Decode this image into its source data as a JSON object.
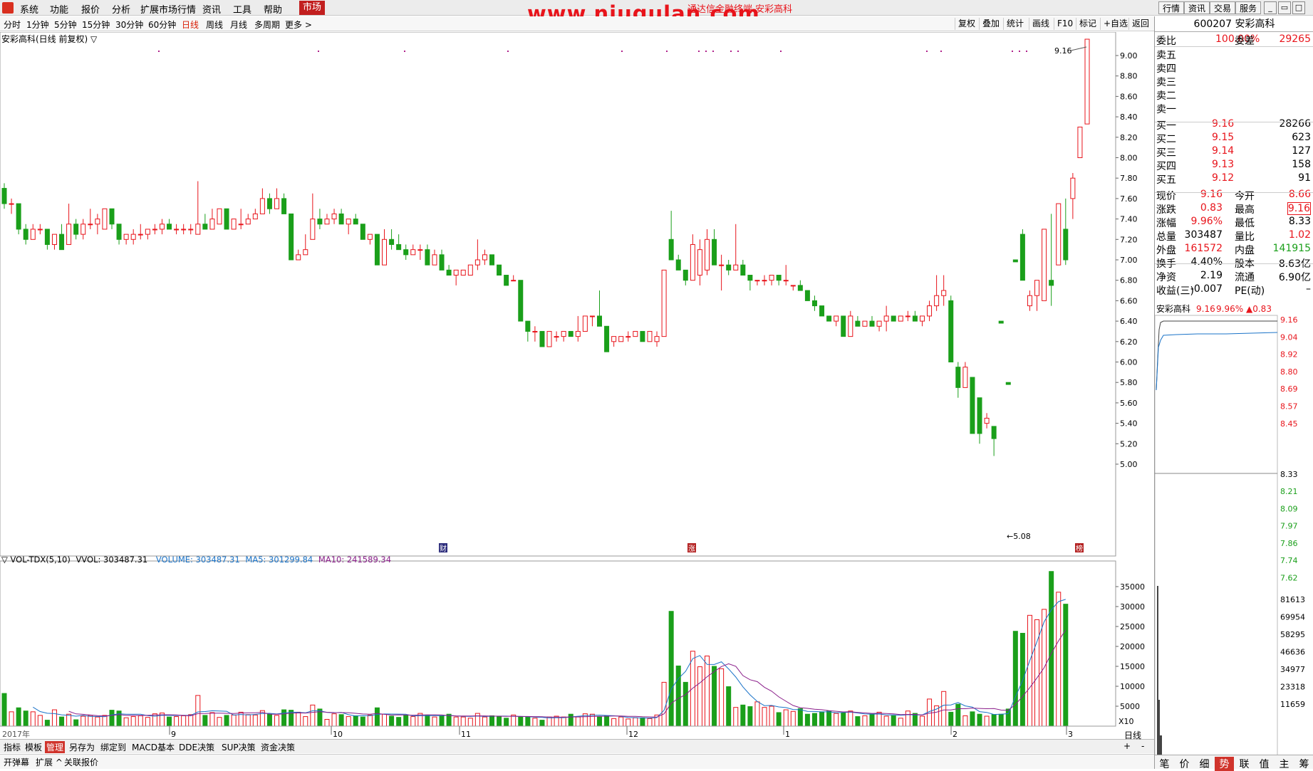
{
  "menu": {
    "items": [
      "系统",
      "功能",
      "报价",
      "分析",
      "扩展市场行情",
      "资讯",
      "工具",
      "帮助"
    ],
    "active": "市场",
    "right": [
      "行情",
      "资讯",
      "交易",
      "服务"
    ],
    "window_controls": [
      "_",
      "▭",
      "□",
      "×"
    ]
  },
  "watermark": {
    "text": "www.niugulan.com",
    "subtitle": "通达信金融终端 安彩高科"
  },
  "periods": {
    "items": [
      "分时",
      "1分钟",
      "5分钟",
      "15分钟",
      "30分钟",
      "60分钟",
      "日线",
      "周线",
      "月线",
      "多周期",
      "更多 >"
    ],
    "active": "日线"
  },
  "chart_tools": [
    "复权",
    "叠加",
    "统计",
    "画线",
    "F10",
    "标记",
    "+自选",
    "返回"
  ],
  "chart_title": "安彩高科(日线 前复权) ▽",
  "price_axis": [
    "9.00",
    "8.80",
    "8.60",
    "8.40",
    "8.20",
    "8.00",
    "7.80",
    "7.60",
    "7.40",
    "7.20",
    "7.00",
    "6.80",
    "6.60",
    "6.40",
    "6.20",
    "6.00",
    "5.80",
    "5.60",
    "5.40",
    "5.20",
    "5.00"
  ],
  "price_annot": {
    "high": "9.16",
    "low": "5.08"
  },
  "vol_header": {
    "name": "▽ VOL-TDX(5,10)",
    "vvol": "VVOL: 303487.31",
    "volume": "VOLUME: 303487.31",
    "ma5": "MA5: 301299.84",
    "ma10": "MA10: 241589.34"
  },
  "vol_axis": [
    "35000",
    "30000",
    "25000",
    "20000",
    "15000",
    "10000",
    "5000"
  ],
  "vol_unit": "X10",
  "date_axis": {
    "year": "2017年",
    "months": [
      "9",
      "10",
      "11",
      "12",
      "1",
      "2",
      "3"
    ]
  },
  "markers": [
    "财",
    "涨",
    "榜"
  ],
  "bottom_tabs": [
    "指标",
    "模板",
    "管理",
    "另存为",
    "绑定到",
    "MACD基本",
    "DDE决策",
    "SUP决策",
    "资金决策"
  ],
  "bottom_active": "管理",
  "bottom_right": [
    "+",
    "-",
    "日线"
  ],
  "status_items": [
    "开弹幕",
    "扩展 ^",
    "关联报价"
  ],
  "quote": {
    "code_name": "600207 安彩高科",
    "wb": {
      "label": "委比",
      "value": "100.00%",
      "label2": "委差",
      "value2": "29265"
    },
    "sells": [
      "卖五",
      "卖四",
      "卖三",
      "卖二",
      "卖一"
    ],
    "buys": [
      {
        "l": "买一",
        "p": "9.16",
        "v": "28266"
      },
      {
        "l": "买二",
        "p": "9.15",
        "v": "623"
      },
      {
        "l": "买三",
        "p": "9.14",
        "v": "127"
      },
      {
        "l": "买四",
        "p": "9.13",
        "v": "158"
      },
      {
        "l": "买五",
        "p": "9.12",
        "v": "91"
      }
    ],
    "stats": [
      {
        "l1": "现价",
        "v1": "9.16",
        "l2": "今开",
        "v2": "8.66"
      },
      {
        "l1": "涨跌",
        "v1": "0.83",
        "l2": "最高",
        "v2": "9.16"
      },
      {
        "l1": "涨幅",
        "v1": "9.96%",
        "l2": "最低",
        "v2": "8.33"
      },
      {
        "l1": "总量",
        "v1": "303487",
        "l2": "量比",
        "v2": "1.02"
      },
      {
        "l1": "外盘",
        "v1": "161572",
        "l2": "内盘",
        "v2": "141915"
      },
      {
        "l1": "换手",
        "v1": "4.40%",
        "l2": "股本",
        "v2": "8.63亿"
      },
      {
        "l1": "净资",
        "v1": "2.19",
        "l2": "流通",
        "v2": "6.90亿"
      },
      {
        "l1": "收益(三)",
        "v1": "-0.007",
        "l2": "PE(动)",
        "v2": "–"
      }
    ],
    "mini_title": "安彩高科",
    "mini_price": "9.16",
    "mini_pct": "9.96%",
    "mini_chg": "▲0.83",
    "mini_axis_red": [
      "9.16",
      "9.04",
      "8.92",
      "8.80",
      "8.69",
      "8.57",
      "8.45"
    ],
    "mini_axis_mid": "8.33",
    "mini_axis_green": [
      "8.21",
      "8.09",
      "7.97",
      "7.86",
      "7.74",
      "7.62"
    ],
    "mini_vol_axis": [
      "81613",
      "69954",
      "58295",
      "46636",
      "34977",
      "23318",
      "11659"
    ],
    "tabs": [
      "笔",
      "价",
      "细",
      "势",
      "联",
      "值",
      "主",
      "筹"
    ],
    "tab_active": "势"
  },
  "chart_data": {
    "type": "candlestick",
    "title": "安彩高科(日线 前复权)",
    "ylim": [
      5.0,
      9.16
    ],
    "candles": [
      [
        7.7,
        7.75,
        7.5,
        7.55
      ],
      [
        7.55,
        7.6,
        7.45,
        7.55
      ],
      [
        7.55,
        7.55,
        7.25,
        7.3
      ],
      [
        7.3,
        7.35,
        7.15,
        7.2
      ],
      [
        7.2,
        7.35,
        7.2,
        7.3
      ],
      [
        7.3,
        7.35,
        7.25,
        7.3
      ],
      [
        7.3,
        7.3,
        7.1,
        7.15
      ],
      [
        7.15,
        7.25,
        7.1,
        7.25
      ],
      [
        7.25,
        7.35,
        7.1,
        7.1
      ],
      [
        7.15,
        7.55,
        7.15,
        7.35
      ],
      [
        7.35,
        7.4,
        7.2,
        7.25
      ],
      [
        7.25,
        7.4,
        7.2,
        7.35
      ],
      [
        7.35,
        7.5,
        7.3,
        7.35
      ],
      [
        7.35,
        7.45,
        7.25,
        7.4
      ],
      [
        7.3,
        7.5,
        7.3,
        7.5
      ],
      [
        7.5,
        7.5,
        7.3,
        7.35
      ],
      [
        7.35,
        7.35,
        7.15,
        7.2
      ],
      [
        7.2,
        7.25,
        7.15,
        7.25
      ],
      [
        7.2,
        7.3,
        7.15,
        7.25
      ],
      [
        7.25,
        7.35,
        7.2,
        7.25
      ],
      [
        7.25,
        7.3,
        7.2,
        7.3
      ],
      [
        7.3,
        7.35,
        7.25,
        7.3
      ],
      [
        7.3,
        7.4,
        7.25,
        7.35
      ],
      [
        7.35,
        7.4,
        7.3,
        7.3
      ],
      [
        7.3,
        7.35,
        7.25,
        7.3
      ],
      [
        7.3,
        7.35,
        7.25,
        7.3
      ],
      [
        7.3,
        7.35,
        7.25,
        7.3
      ],
      [
        7.25,
        7.77,
        7.25,
        7.35
      ],
      [
        7.35,
        7.45,
        7.3,
        7.3
      ],
      [
        7.3,
        7.5,
        7.3,
        7.4
      ],
      [
        7.35,
        7.5,
        7.35,
        7.5
      ],
      [
        7.5,
        7.5,
        7.3,
        7.3
      ],
      [
        7.3,
        7.4,
        7.3,
        7.4
      ],
      [
        7.35,
        7.5,
        7.3,
        7.35
      ],
      [
        7.35,
        7.45,
        7.35,
        7.4
      ],
      [
        7.4,
        7.5,
        7.4,
        7.45
      ],
      [
        7.45,
        7.7,
        7.45,
        7.6
      ],
      [
        7.6,
        7.65,
        7.45,
        7.5
      ],
      [
        7.5,
        7.7,
        7.5,
        7.6
      ],
      [
        7.6,
        7.65,
        7.45,
        7.45
      ],
      [
        7.45,
        7.45,
        7.15,
        7.0
      ],
      [
        7.0,
        7.1,
        7.0,
        7.05
      ],
      [
        7.05,
        7.25,
        7.05,
        7.1
      ],
      [
        7.2,
        7.65,
        7.2,
        7.4
      ],
      [
        7.4,
        7.5,
        7.3,
        7.35
      ],
      [
        7.35,
        7.45,
        7.35,
        7.4
      ],
      [
        7.4,
        7.5,
        7.35,
        7.45
      ],
      [
        7.45,
        7.5,
        7.35,
        7.35
      ],
      [
        7.35,
        7.4,
        7.25,
        7.4
      ],
      [
        7.4,
        7.45,
        7.35,
        7.35
      ],
      [
        7.35,
        7.35,
        7.2,
        7.2
      ],
      [
        7.2,
        7.25,
        7.15,
        7.25
      ],
      [
        7.25,
        7.25,
        6.95,
        6.95
      ],
      [
        6.95,
        7.3,
        6.95,
        7.2
      ],
      [
        7.2,
        7.3,
        7.1,
        7.15
      ],
      [
        7.15,
        7.25,
        7.1,
        7.1
      ],
      [
        7.1,
        7.15,
        7.0,
        7.05
      ],
      [
        7.05,
        7.15,
        7.05,
        7.1
      ],
      [
        7.1,
        7.15,
        7.0,
        7.1
      ],
      [
        7.1,
        7.15,
        6.95,
        6.95
      ],
      [
        6.95,
        7.1,
        6.95,
        7.05
      ],
      [
        7.05,
        7.1,
        6.9,
        6.9
      ],
      [
        6.9,
        6.95,
        6.85,
        6.85
      ],
      [
        6.85,
        6.9,
        6.75,
        6.9
      ],
      [
        6.85,
        6.9,
        6.85,
        6.9
      ],
      [
        6.85,
        6.95,
        6.85,
        6.95
      ],
      [
        6.95,
        7.2,
        6.9,
        7.0
      ],
      [
        7.0,
        7.1,
        6.95,
        7.05
      ],
      [
        7.05,
        7.05,
        6.95,
        6.95
      ],
      [
        6.95,
        6.95,
        6.85,
        6.85
      ],
      [
        6.85,
        6.85,
        6.75,
        6.75
      ],
      [
        6.8,
        6.85,
        6.8,
        6.8
      ],
      [
        6.8,
        6.8,
        6.4,
        6.4
      ],
      [
        6.4,
        6.4,
        6.2,
        6.3
      ],
      [
        6.3,
        6.35,
        6.2,
        6.3
      ],
      [
        6.3,
        6.3,
        6.15,
        6.15
      ],
      [
        6.15,
        6.3,
        6.15,
        6.3
      ],
      [
        6.25,
        6.3,
        6.2,
        6.25
      ],
      [
        6.25,
        6.3,
        6.2,
        6.3
      ],
      [
        6.3,
        6.3,
        6.25,
        6.25
      ],
      [
        6.25,
        6.45,
        6.2,
        6.3
      ],
      [
        6.3,
        6.45,
        6.3,
        6.45
      ],
      [
        6.45,
        6.45,
        6.35,
        6.45
      ],
      [
        6.45,
        6.7,
        6.35,
        6.35
      ],
      [
        6.35,
        6.35,
        6.15,
        6.1
      ],
      [
        6.2,
        6.25,
        6.15,
        6.25
      ],
      [
        6.2,
        6.25,
        6.2,
        6.25
      ],
      [
        6.25,
        6.3,
        6.2,
        6.25
      ],
      [
        6.25,
        6.3,
        6.25,
        6.3
      ],
      [
        6.3,
        6.3,
        6.2,
        6.2
      ],
      [
        6.2,
        6.3,
        6.2,
        6.3
      ],
      [
        6.2,
        6.3,
        6.15,
        6.25
      ],
      [
        6.25,
        6.9,
        6.25,
        6.9
      ],
      [
        7.2,
        7.48,
        7.05,
        7.0
      ],
      [
        7.0,
        7.05,
        6.9,
        6.9
      ],
      [
        6.9,
        6.9,
        6.75,
        6.8
      ],
      [
        6.8,
        7.25,
        6.8,
        7.15
      ],
      [
        6.85,
        7.2,
        6.75,
        7.1
      ],
      [
        6.9,
        7.3,
        6.85,
        7.2
      ],
      [
        7.2,
        7.3,
        6.95,
        6.95
      ],
      [
        6.95,
        7.05,
        6.7,
        6.95
      ],
      [
        6.95,
        7.0,
        6.85,
        6.9
      ],
      [
        6.9,
        7.35,
        6.9,
        6.95
      ],
      [
        6.95,
        7.0,
        6.85,
        6.85
      ],
      [
        6.85,
        6.85,
        6.7,
        6.8
      ],
      [
        6.8,
        6.8,
        6.75,
        6.8
      ],
      [
        6.8,
        6.85,
        6.75,
        6.8
      ],
      [
        6.8,
        6.85,
        6.75,
        6.85
      ],
      [
        6.85,
        6.85,
        6.75,
        6.8
      ],
      [
        6.8,
        6.95,
        6.75,
        6.8
      ],
      [
        6.75,
        6.75,
        6.7,
        6.75
      ],
      [
        6.75,
        6.8,
        6.7,
        6.7
      ],
      [
        6.7,
        6.7,
        6.6,
        6.6
      ],
      [
        6.6,
        6.65,
        6.5,
        6.55
      ],
      [
        6.55,
        6.55,
        6.45,
        6.45
      ],
      [
        6.45,
        6.45,
        6.4,
        6.4
      ],
      [
        6.4,
        6.45,
        6.35,
        6.45
      ],
      [
        6.45,
        6.45,
        6.25,
        6.25
      ],
      [
        6.25,
        6.5,
        6.25,
        6.45
      ],
      [
        6.4,
        6.45,
        6.35,
        6.35
      ],
      [
        6.35,
        6.4,
        6.35,
        6.4
      ],
      [
        6.4,
        6.45,
        6.35,
        6.35
      ],
      [
        6.35,
        6.4,
        6.3,
        6.4
      ],
      [
        6.4,
        6.55,
        6.3,
        6.45
      ],
      [
        6.45,
        6.45,
        6.4,
        6.4
      ],
      [
        6.4,
        6.45,
        6.4,
        6.45
      ],
      [
        6.45,
        6.5,
        6.4,
        6.45
      ],
      [
        6.45,
        6.5,
        6.4,
        6.4
      ],
      [
        6.4,
        6.45,
        6.35,
        6.45
      ],
      [
        6.45,
        6.6,
        6.4,
        6.55
      ],
      [
        6.55,
        6.85,
        6.5,
        6.65
      ],
      [
        6.65,
        6.85,
        6.55,
        6.7
      ],
      [
        6.6,
        6.65,
        6.0,
        6.0
      ],
      [
        5.95,
        6.0,
        5.65,
        5.75
      ],
      [
        5.75,
        6.0,
        5.75,
        5.95
      ],
      [
        5.85,
        5.85,
        5.3,
        5.3
      ],
      [
        5.65,
        5.65,
        5.2,
        5.3
      ],
      [
        5.4,
        5.5,
        5.35,
        5.45
      ],
      [
        5.37,
        5.37,
        5.08,
        5.25
      ],
      [
        6.4,
        6.4,
        6.38,
        6.38
      ],
      [
        5.8,
        5.8,
        5.78,
        5.78
      ],
      [
        7.0,
        7.0,
        6.98,
        6.98
      ],
      [
        7.25,
        7.3,
        6.8,
        6.8
      ],
      [
        6.55,
        6.7,
        6.5,
        6.65
      ],
      [
        6.65,
        6.8,
        6.5,
        6.8
      ],
      [
        6.6,
        7.3,
        6.6,
        7.3
      ],
      [
        6.8,
        7.45,
        6.55,
        6.75
      ],
      [
        6.95,
        7.55,
        6.95,
        7.55
      ],
      [
        7.3,
        7.6,
        6.95,
        7.0
      ],
      [
        7.6,
        7.85,
        7.4,
        7.8
      ],
      [
        8.0,
        8.3,
        8.0,
        8.3
      ],
      [
        8.33,
        9.16,
        8.33,
        9.16
      ]
    ],
    "volume_x10": [
      8200,
      3600,
      4600,
      3800,
      3600,
      2700,
      1500,
      4100,
      2300,
      3000,
      1600,
      2500,
      2700,
      2300,
      2700,
      4000,
      3800,
      2100,
      2400,
      2600,
      2200,
      3100,
      3300,
      2300,
      2400,
      2600,
      2900,
      7700,
      2700,
      3400,
      2200,
      2700,
      2800,
      3500,
      2900,
      2800,
      3900,
      3000,
      2700,
      4100,
      4000,
      3500,
      2400,
      5300,
      4300,
      1700,
      3100,
      2900,
      2400,
      2600,
      2300,
      2800,
      4600,
      3000,
      2500,
      2200,
      2700,
      2400,
      3200,
      2700,
      2300,
      2500,
      3000,
      2300,
      2300,
      2000,
      3200,
      2300,
      2600,
      2500,
      2000,
      2800,
      2300,
      2300,
      2000,
      1500,
      2300,
      2500,
      2300,
      3000,
      2300,
      3100,
      3000,
      2400,
      2600,
      1900,
      2300,
      1800,
      2100,
      2100,
      1900,
      2800,
      11000,
      28800,
      15100,
      11000,
      18800,
      14900,
      17600,
      15000,
      14400,
      9900,
      4700,
      5300,
      4900,
      6100,
      4700,
      5000,
      3400,
      4100,
      3700,
      4400,
      3000,
      3200,
      3600,
      3800,
      3200,
      3300,
      3800,
      2400,
      2600,
      3000,
      3500,
      2500,
      2600,
      2000,
      3800,
      3200,
      2500,
      6800,
      5100,
      8700,
      3500,
      5500,
      2600,
      3600,
      3000,
      2500,
      2900,
      3000,
      4300,
      23800,
      23300,
      27800,
      26700,
      29300,
      38800,
      33600,
      30600
    ],
    "vol_colors_note": "red hollow for up days, green filled for down days"
  }
}
